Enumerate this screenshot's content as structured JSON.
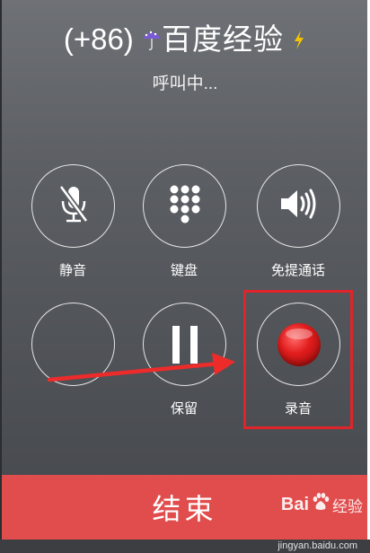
{
  "caller": {
    "number": "(+86)",
    "name": "百度经验",
    "status": "呼叫中..."
  },
  "buttons": {
    "mute": {
      "label": "静音",
      "icon": "mic-muted-icon"
    },
    "keypad": {
      "label": "键盘",
      "icon": "keypad-icon"
    },
    "speaker": {
      "label": "免提通话",
      "icon": "speaker-icon"
    },
    "blank": {
      "label": ""
    },
    "hold": {
      "label": "保留",
      "icon": "pause-icon"
    },
    "record": {
      "label": "录音",
      "icon": "record-icon"
    }
  },
  "end_call": {
    "label": "结束"
  },
  "watermark": {
    "brand_latin": "Bai",
    "brand_cn": "经验",
    "url": "jingyan.baidu.com"
  },
  "colors": {
    "end_bar": "#e14d4d",
    "highlight": "#e0242a",
    "record_dot": "#e21d1d"
  }
}
